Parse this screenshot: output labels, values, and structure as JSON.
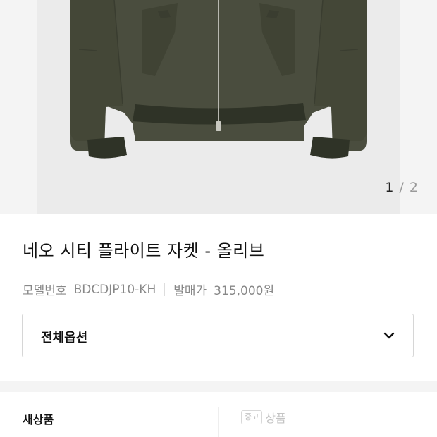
{
  "gallery": {
    "current": "1",
    "separator": "/",
    "total": "2"
  },
  "product": {
    "title": "네오 시티 플라이트 자켓 - 올리브",
    "model_label": "모델번호",
    "model_value": "BDCDJP10-KH",
    "release_label": "발매가",
    "release_value": "315,000원"
  },
  "option": {
    "label": "전체옵션"
  },
  "condition_tabs": {
    "new_label": "새상품",
    "used_badge": "중고",
    "used_label": "상품"
  },
  "colors": {
    "jacket": "#4a4d3e",
    "rib": "#2f3327",
    "accent": "#111111"
  }
}
